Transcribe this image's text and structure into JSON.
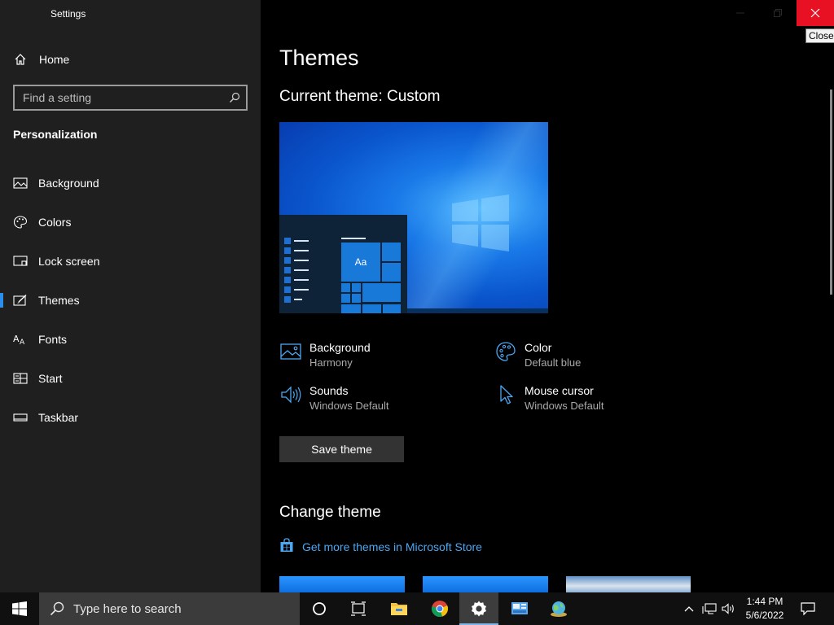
{
  "window": {
    "title": "Settings",
    "close_tooltip": "Close"
  },
  "sidebar": {
    "home_label": "Home",
    "search_placeholder": "Find a setting",
    "section_title": "Personalization",
    "items": [
      {
        "label": "Background",
        "icon": "image-icon"
      },
      {
        "label": "Colors",
        "icon": "palette-icon"
      },
      {
        "label": "Lock screen",
        "icon": "lock-screen-icon"
      },
      {
        "label": "Themes",
        "icon": "brush-icon",
        "active": true
      },
      {
        "label": "Fonts",
        "icon": "font-icon"
      },
      {
        "label": "Start",
        "icon": "start-icon"
      },
      {
        "label": "Taskbar",
        "icon": "taskbar-icon"
      }
    ]
  },
  "main": {
    "title": "Themes",
    "current_theme": "Current theme: Custom",
    "preview_tile_text": "Aa",
    "properties": {
      "background": {
        "name": "Background",
        "value": "Harmony"
      },
      "color": {
        "name": "Color",
        "value": "Default blue"
      },
      "sounds": {
        "name": "Sounds",
        "value": "Windows Default"
      },
      "mouse_cursor": {
        "name": "Mouse cursor",
        "value": "Windows Default"
      }
    },
    "save_button": "Save theme",
    "change_theme_title": "Change theme",
    "store_link": "Get more themes in Microsoft Store"
  },
  "taskbar": {
    "search_placeholder": "Type here to search",
    "apps": [
      "cortana-icon",
      "task-view-icon",
      "file-explorer-icon",
      "chrome-icon",
      "settings-icon",
      "control-panel-icon",
      "network-globe-icon"
    ],
    "time": "1:44 PM",
    "date": "5/6/2022"
  },
  "colors": {
    "accent": "#2a8eea",
    "link": "#4ca6f0",
    "close_hover": "#e81123"
  }
}
